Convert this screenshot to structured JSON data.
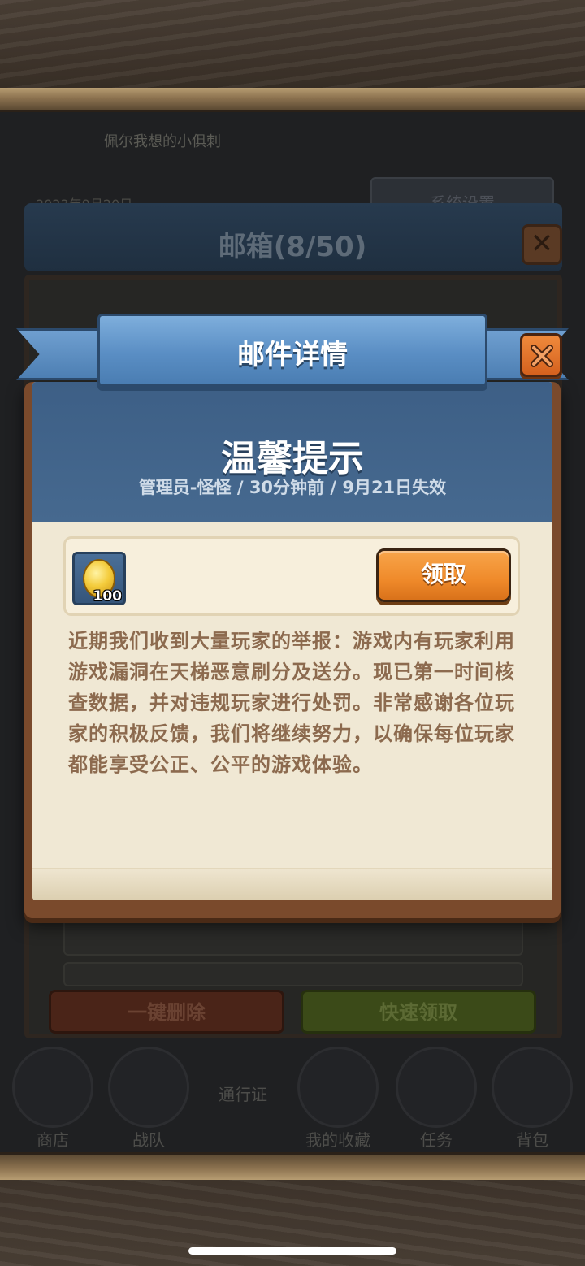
{
  "background": {
    "top_label": "佩尔我想的小俱刺",
    "date_text": "2023年9月20日",
    "panel_button": "系统设置",
    "mailbox_title": "邮箱(8/50)",
    "delete_all_label": "一键删除",
    "quick_claim_label": "快速领取",
    "nav": [
      {
        "label": "商店"
      },
      {
        "label": "战队"
      },
      {
        "label": "通行证"
      },
      {
        "label": "我的收藏"
      },
      {
        "label": "任务"
      },
      {
        "label": "背包"
      }
    ]
  },
  "dialog": {
    "ribbon_title": "邮件详情",
    "mail_title": "温馨提示",
    "mail_meta": "管理员-怪怪 / 30分钟前 /  9月21日失效",
    "attachment": {
      "icon": "gold-coin-icon",
      "count": "100"
    },
    "claim_label": "领取",
    "body": "近期我们收到大量玩家的举报：游戏内有玩家利用游戏漏洞在天梯恶意刷分及送分。现已第一时间核查数据，并对违规玩家进行处罚。非常感谢各位玩家的积极反馈，我们将继续努力，以确保每位玩家都能享受公正、公平的游戏体验。"
  },
  "colors": {
    "header_blue": "#46698f",
    "ribbon_blue": "#5a8ec4",
    "claim_orange": "#ef8a2a",
    "body_text": "#8c6a4e",
    "paper": "#f0e8d4"
  }
}
